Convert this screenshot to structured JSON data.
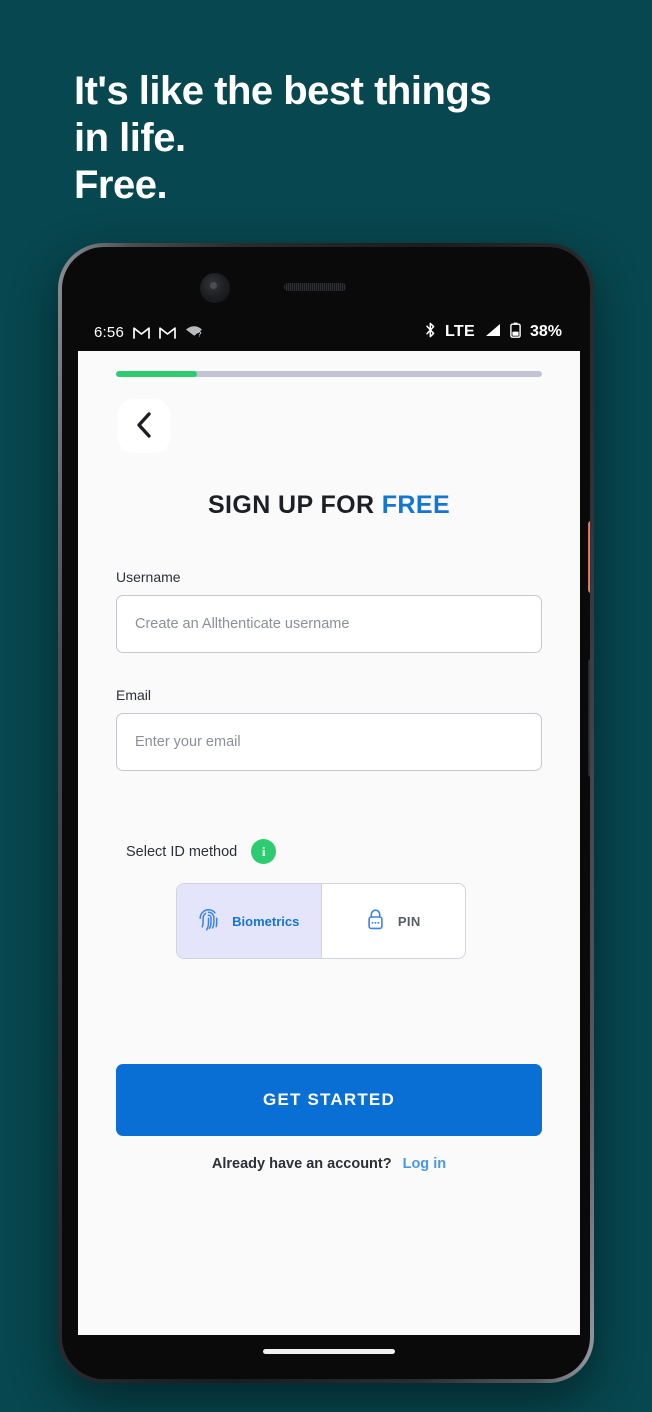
{
  "promo": {
    "headline": "It's like the best things\nin life.\nFree.",
    "background_color": "#07474f",
    "text_color": "#ffffff"
  },
  "device": {
    "power_button_color": "#f59d83",
    "volume_button_color": "#3d4044",
    "front_camera": "front-camera",
    "earpiece": "earpiece-speaker"
  },
  "status_bar": {
    "time": "6:56",
    "left_icons": [
      "gmail-icon",
      "gmail-icon",
      "wifi-question-icon"
    ],
    "bluetooth": "bluetooth-icon",
    "network": "LTE",
    "signal": "signal-bars-icon",
    "battery_icon": "battery-icon",
    "battery": "38%"
  },
  "app": {
    "progress": {
      "percent": 19,
      "fill_color": "#2ecc71",
      "track_color": "#c2c4d4"
    },
    "back_button": "back-chevron",
    "title": {
      "main": "SIGN UP FOR ",
      "accent": "FREE",
      "accent_color": "#1476d1"
    },
    "fields": [
      {
        "label": "Username",
        "placeholder": "Create an Allthenticate username",
        "value": ""
      },
      {
        "label": "Email",
        "placeholder": "Enter your email",
        "value": ""
      }
    ],
    "id_method": {
      "label": "Select ID method",
      "info_badge": "i",
      "info_badge_color": "#2ecc71",
      "options": [
        {
          "label": "Biometrics",
          "icon": "fingerprint-icon",
          "selected": true
        },
        {
          "label": "PIN",
          "icon": "lock-icon",
          "selected": false
        }
      ]
    },
    "cta": {
      "label": "GET STARTED",
      "color": "#0a6fd4"
    },
    "login": {
      "prompt": "Already have an account?",
      "link": "Log in",
      "link_color": "#4a97e8"
    }
  }
}
